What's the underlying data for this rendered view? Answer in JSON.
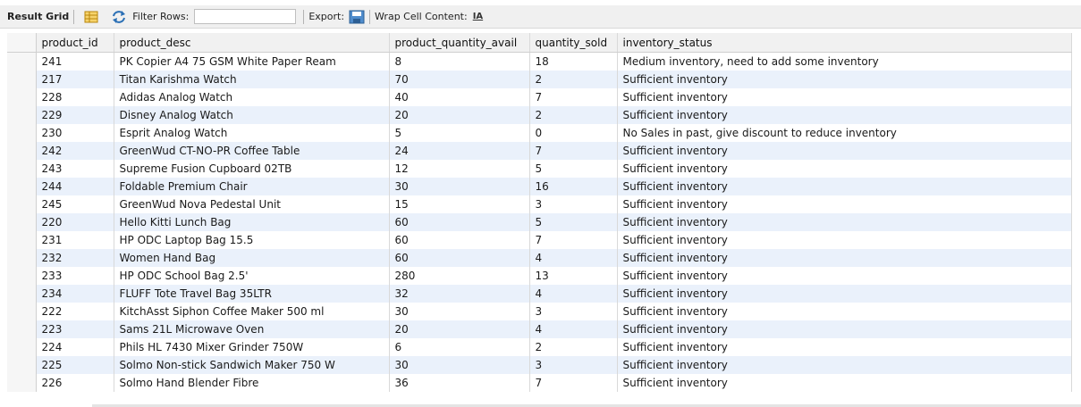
{
  "toolbar": {
    "result_grid_label": "Result Grid",
    "grid_icon": "grid-icon",
    "refresh_icon": "refresh-icon",
    "filter_label": "Filter Rows:",
    "filter_value": "",
    "export_label": "Export:",
    "export_icon": "save-export-icon",
    "wrap_label": "Wrap Cell Content:",
    "wrap_icon_text": "IA"
  },
  "table": {
    "columns": [
      "product_id",
      "product_desc",
      "product_quantity_avail",
      "quantity_sold",
      "inventory_status"
    ],
    "rows": [
      [
        "241",
        "PK Copier A4 75 GSM White Paper Ream",
        "8",
        "18",
        "Medium inventory, need to add some inventory"
      ],
      [
        "217",
        "Titan Karishma Watch",
        "70",
        "2",
        "Sufficient inventory"
      ],
      [
        "228",
        "Adidas Analog Watch",
        "40",
        "7",
        "Sufficient inventory"
      ],
      [
        "229",
        "Disney Analog Watch",
        "20",
        "2",
        "Sufficient inventory"
      ],
      [
        "230",
        "Esprit Analog Watch",
        "5",
        "0",
        "No Sales in past, give discount to reduce inventory"
      ],
      [
        "242",
        "GreenWud CT-NO-PR Coffee Table",
        "24",
        "7",
        "Sufficient inventory"
      ],
      [
        "243",
        "Supreme Fusion Cupboard 02TB",
        "12",
        "5",
        "Sufficient inventory"
      ],
      [
        "244",
        "Foldable Premium Chair",
        "30",
        "16",
        "Sufficient inventory"
      ],
      [
        "245",
        "GreenWud Nova Pedestal Unit",
        "15",
        "3",
        "Sufficient inventory"
      ],
      [
        "220",
        "Hello Kitti Lunch Bag",
        "60",
        "5",
        "Sufficient inventory"
      ],
      [
        "231",
        "HP ODC Laptop Bag 15.5",
        "60",
        "7",
        "Sufficient inventory"
      ],
      [
        "232",
        "Women Hand Bag",
        "60",
        "4",
        "Sufficient inventory"
      ],
      [
        "233",
        "HP ODC School Bag 2.5'",
        "280",
        "13",
        "Sufficient inventory"
      ],
      [
        "234",
        "FLUFF Tote Travel Bag 35LTR",
        "32",
        "4",
        "Sufficient inventory"
      ],
      [
        "222",
        "KitchAsst Siphon Coffee Maker 500 ml",
        "30",
        "3",
        "Sufficient inventory"
      ],
      [
        "223",
        "Sams 21L Microwave Oven",
        "20",
        "4",
        "Sufficient inventory"
      ],
      [
        "224",
        "Phils HL 7430 Mixer Grinder 750W",
        "6",
        "2",
        "Sufficient inventory"
      ],
      [
        "225",
        "Solmo Non-stick Sandwich Maker 750 W",
        "30",
        "3",
        "Sufficient inventory"
      ],
      [
        "226",
        "Solmo Hand Blender Fibre",
        "36",
        "7",
        "Sufficient inventory"
      ]
    ]
  },
  "colors": {
    "row_alt": "#eaf1fb",
    "header_bg": "#f1f1f1",
    "toolbar_bg": "#f0f0f0"
  }
}
